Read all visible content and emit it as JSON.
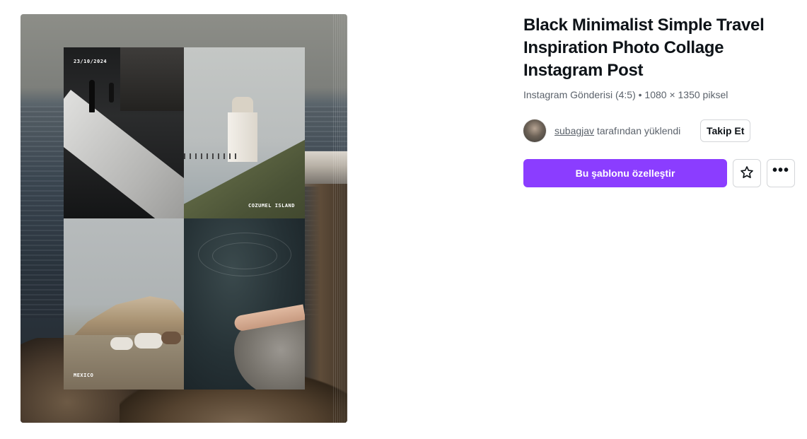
{
  "preview": {
    "date_label": "23/10/2024",
    "cozumel_label": "COZUMEL ISLAND",
    "mexico_label": "MEXICO"
  },
  "template": {
    "title": "Black Minimalist Simple Travel Inspiration Photo Collage Instagram Post",
    "subtitle": "Instagram Gönderisi (4:5) • 1080 × 1350 piksel"
  },
  "creator": {
    "username": "subagjav",
    "uploaded_by_suffix": " tarafından yüklendi",
    "follow_label": "Takip Et"
  },
  "actions": {
    "customize_label": "Bu şablonu özelleştir",
    "favorite_icon": "star-icon",
    "more_icon": "more-horizontal-icon",
    "more_glyph": "•••"
  },
  "colors": {
    "primary": "#8b3dff",
    "text": "#0e1318",
    "muted": "#5b626b",
    "border": "#d4d6d9"
  }
}
